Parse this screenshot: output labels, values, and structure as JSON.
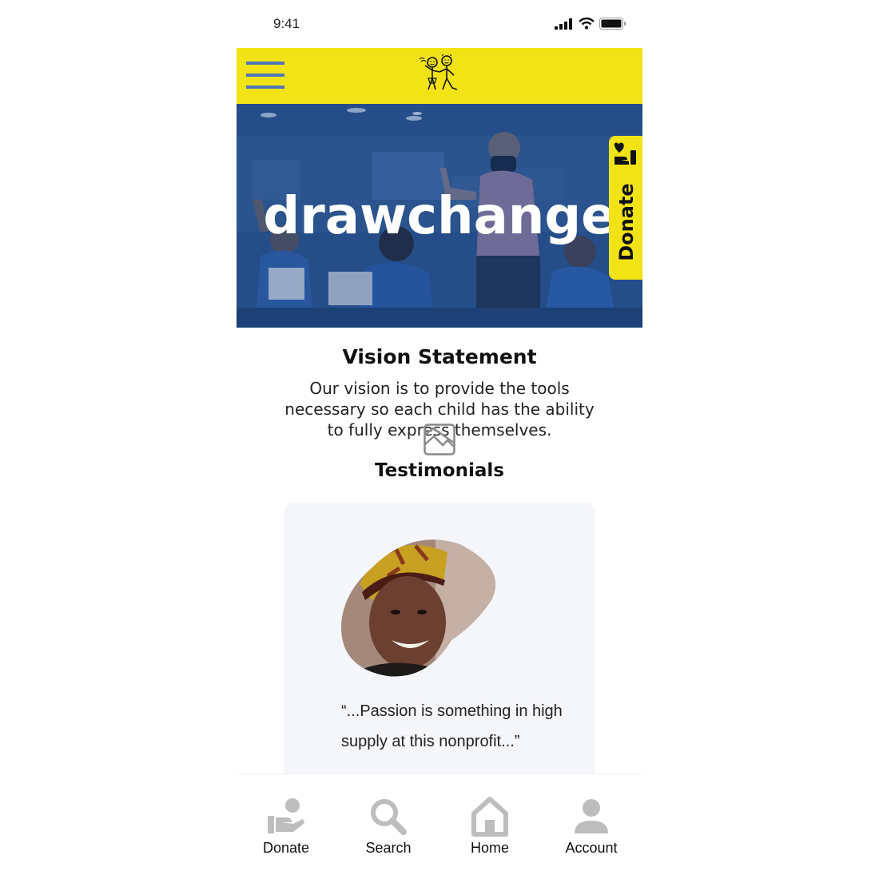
{
  "status_bar": {
    "time": "9:41"
  },
  "hero": {
    "title": "drawchange"
  },
  "donate_tab": {
    "label": "Donate"
  },
  "vision": {
    "title": "Vision Statement",
    "text": "Our vision is to provide the tools necessary so each child has the ability to fully express themselves."
  },
  "testimonials": {
    "title": "Testimonials",
    "quote": "“...Passion is something in high supply at this nonprofit...”"
  },
  "bottom_nav": {
    "items": [
      {
        "label": "Donate",
        "icon": "donate-icon"
      },
      {
        "label": "Search",
        "icon": "search-icon"
      },
      {
        "label": "Home",
        "icon": "home-icon"
      },
      {
        "label": "Account",
        "icon": "account-icon"
      }
    ]
  },
  "colors": {
    "brand_yellow": "#f2e316",
    "menu_blue": "#4f76b9",
    "hero_overlay": "#1e4a8c"
  }
}
